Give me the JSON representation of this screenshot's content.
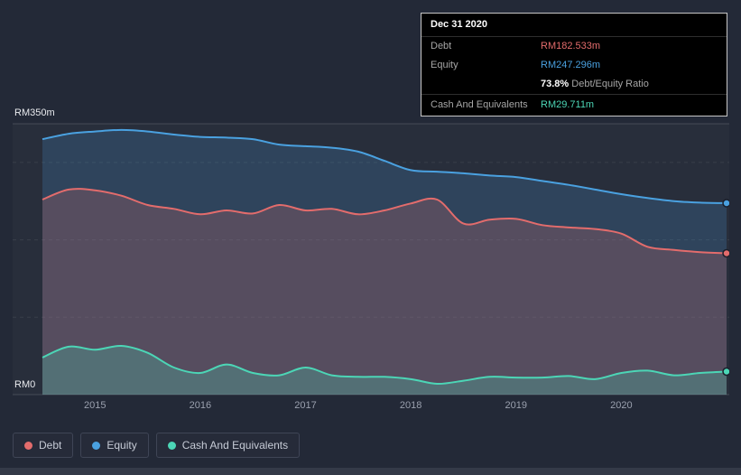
{
  "colors": {
    "debt": "#e36c6c",
    "equity": "#4aa1e0",
    "cash": "#4cd6b6",
    "background": "#232937"
  },
  "axis": {
    "y_max_label": "RM350m",
    "y_min_label": "RM0",
    "x_ticks": [
      "2015",
      "2016",
      "2017",
      "2018",
      "2019",
      "2020"
    ]
  },
  "tooltip": {
    "date": "Dec 31 2020",
    "debt_label": "Debt",
    "debt_value": "RM182.533m",
    "equity_label": "Equity",
    "equity_value": "RM247.296m",
    "ratio_value": "73.8%",
    "ratio_label": "Debt/Equity Ratio",
    "cash_label": "Cash And Equivalents",
    "cash_value": "RM29.711m"
  },
  "legend": {
    "items": [
      {
        "label": "Debt",
        "color_key": "debt"
      },
      {
        "label": "Equity",
        "color_key": "equity"
      },
      {
        "label": "Cash And Equivalents",
        "color_key": "cash"
      }
    ]
  },
  "chart_data": {
    "type": "area",
    "title": "",
    "units": "RM millions",
    "xlim": [
      2014.5,
      2021.0
    ],
    "ylim": [
      0,
      350
    ],
    "y_gridlines": [
      100,
      200,
      300
    ],
    "grid": "dashed-horizontal",
    "legend_position": "bottom",
    "x": [
      2014.5,
      2014.75,
      2015,
      2015.25,
      2015.5,
      2015.75,
      2016,
      2016.25,
      2016.5,
      2016.75,
      2017,
      2017.25,
      2017.5,
      2017.75,
      2018,
      2018.25,
      2018.5,
      2018.75,
      2019,
      2019.25,
      2019.5,
      2019.75,
      2020,
      2020.25,
      2020.5,
      2020.75,
      2021
    ],
    "series": [
      {
        "name": "Equity",
        "color": "#4aa1e0",
        "fill": "rgba(74,161,224,0.20)",
        "values": [
          330,
          337,
          340,
          342,
          340,
          336,
          333,
          332,
          330,
          323,
          321,
          319,
          314,
          302,
          290,
          288,
          286,
          283,
          281,
          276,
          271,
          265,
          259,
          254,
          250,
          248,
          247.296
        ]
      },
      {
        "name": "Debt",
        "color": "#e36c6c",
        "fill": "rgba(227,108,108,0.22)",
        "values": [
          252,
          265,
          264,
          257,
          245,
          240,
          233,
          238,
          234,
          245,
          238,
          240,
          233,
          238,
          247,
          252,
          221,
          226,
          227,
          219,
          216,
          214,
          208,
          191,
          187,
          184,
          182.533
        ]
      },
      {
        "name": "Cash And Equivalents",
        "color": "#4cd6b6",
        "fill": "rgba(76,214,182,0.25)",
        "values": [
          48,
          62,
          58,
          63,
          54,
          35,
          28,
          39,
          28,
          25,
          35,
          25,
          23,
          23,
          20,
          14,
          18,
          23,
          22,
          22,
          24,
          20,
          28,
          31,
          25,
          28,
          29.711
        ]
      }
    ]
  }
}
